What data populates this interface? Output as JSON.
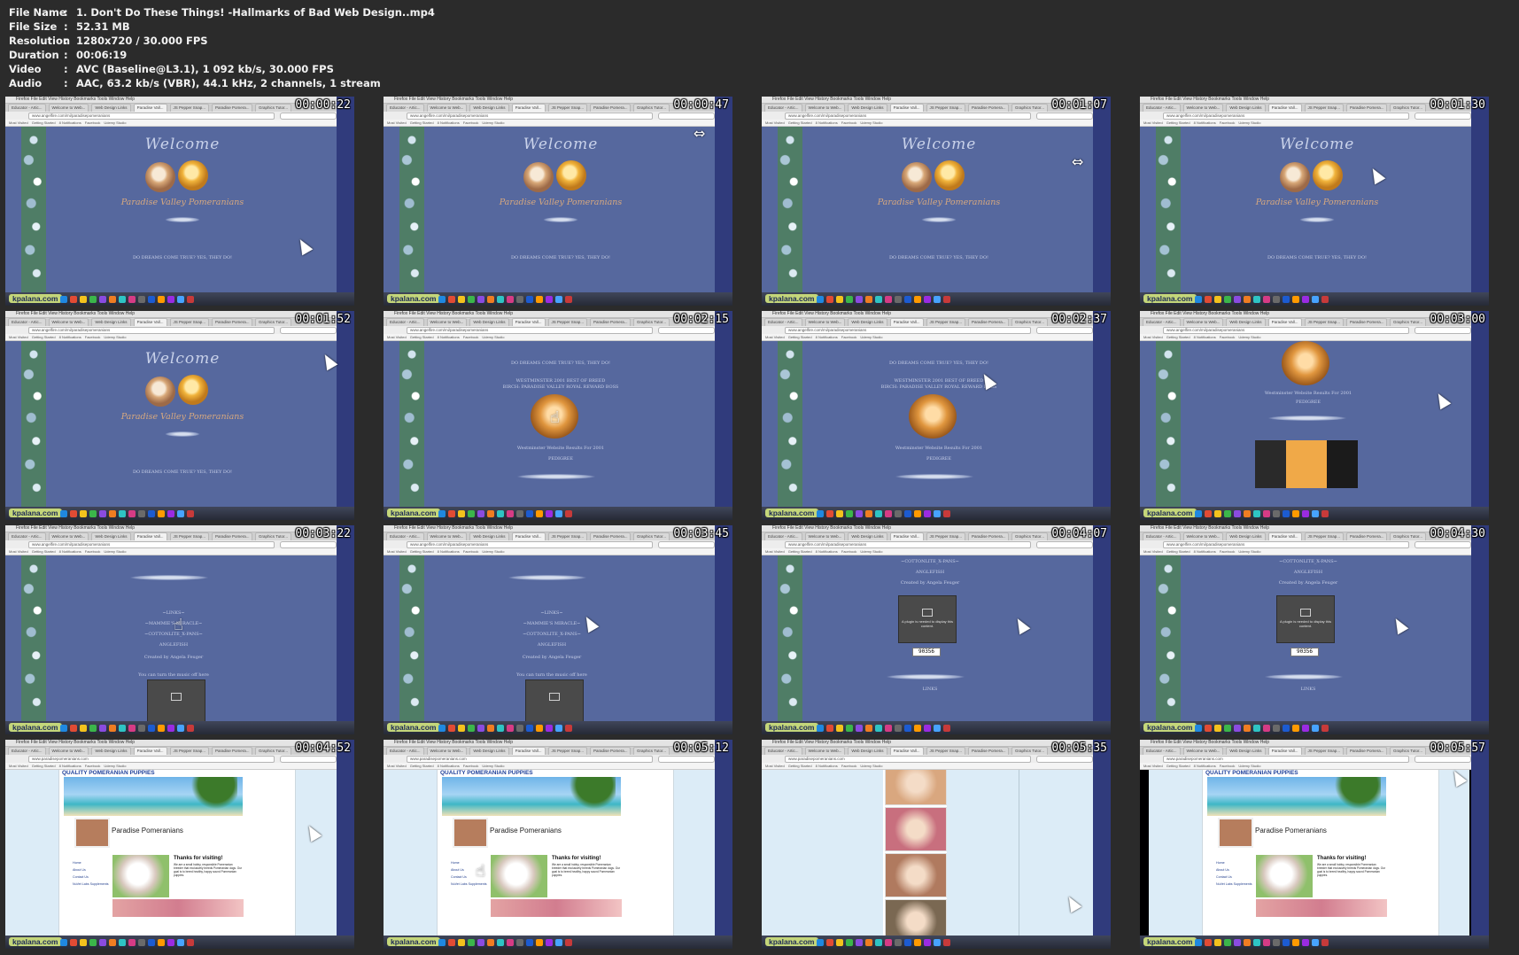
{
  "header": {
    "rows": [
      {
        "key": "File Name",
        "value": "1. Don't Do These Things! -Hallmarks of Bad Web Design..mp4"
      },
      {
        "key": "File Size",
        "value": "52.31 MB"
      },
      {
        "key": "Resolution",
        "value": "1280x720 / 30.000 FPS"
      },
      {
        "key": "Duration",
        "value": "00:06:19"
      },
      {
        "key": "Video",
        "value": "AVC (Baseline@L3.1), 1 092 kb/s, 30.000 FPS"
      },
      {
        "key": "Audio",
        "value": "AAC, 63.2 kb/s (VBR), 44.1 kHz, 2 channels, 1 stream"
      }
    ],
    "separator": ":"
  },
  "browser": {
    "app_menu": "Firefox  File  Edit  View  History  Bookmarks  Tools  Window  Help",
    "bookmarks": [
      "Most Visited",
      "Getting Started",
      "8 Notifications",
      "Facebook",
      "Udemy Studio"
    ],
    "tabs": [
      "Educator - Artic...",
      "Welcome to Web...",
      "Web Design Links",
      "Paradise Vall...",
      "JS Pepper Snap...",
      "Paradise Pomera...",
      "Graphics Tutor..."
    ],
    "url_angelfire": "www.angelfire.com/mi/paradisepomeranians",
    "url_paradise": "www.paradisepomeranians.com"
  },
  "brand": "kpalana.com",
  "site_text": {
    "welcome": "Welcome",
    "valley": "Paradise Valley Pomeranians",
    "dreams": "DO DREAMS COME TRUE?   YES, THEY DO!",
    "westminster": "WESTMINSTER 2001 BEST OF BREED",
    "birch": "BIRCH: PARADISE VALLEY ROYAL REWARD BOSS",
    "result": "Westminster Website Results For 2001",
    "pedigree": "PEDIGREE",
    "links": "~LINKS~",
    "miracle": "~MAMMIE'S MIRACLE~",
    "cottonlite": "~COTTONLITE_X-PANS~",
    "english": "ANGLEFISH",
    "created": "Created by Angela Feuger",
    "music": "You can turn the music off here",
    "plugin": "A plugin is needed to display this content.",
    "counter": "90356",
    "links_bottom": "LINKS",
    "quality": "QUALITY POMERANIAN PUPPIES",
    "pp_name": "Paradise Pomeranians",
    "thanks": "Thanks for visiting!",
    "pp_para": "We are a small hobby, responsible Pomeranian breeder that exclusively breeds Pomeranian dogs. Our goal is to breed healthy, happy sound Pomeranian puppies.",
    "nav": [
      "Home",
      "About Us",
      "Contact Us",
      "NuVet Labs Supplements"
    ]
  },
  "thumbnails": [
    {
      "timestamp": "00:00:22",
      "scene": "welcome"
    },
    {
      "timestamp": "00:00:47",
      "scene": "welcome"
    },
    {
      "timestamp": "00:01:07",
      "scene": "welcome"
    },
    {
      "timestamp": "00:01:30",
      "scene": "welcome"
    },
    {
      "timestamp": "00:01:52",
      "scene": "welcome"
    },
    {
      "timestamp": "00:02:15",
      "scene": "dog"
    },
    {
      "timestamp": "00:02:37",
      "scene": "dog"
    },
    {
      "timestamp": "00:03:00",
      "scene": "pedigree"
    },
    {
      "timestamp": "00:03:22",
      "scene": "links"
    },
    {
      "timestamp": "00:03:45",
      "scene": "links"
    },
    {
      "timestamp": "00:04:07",
      "scene": "plugin"
    },
    {
      "timestamp": "00:04:30",
      "scene": "plugin"
    },
    {
      "timestamp": "00:04:52",
      "scene": "pom"
    },
    {
      "timestamp": "00:05:12",
      "scene": "pom"
    },
    {
      "timestamp": "00:05:35",
      "scene": "photos"
    },
    {
      "timestamp": "00:05:57",
      "scene": "pom-black"
    }
  ],
  "colors": {
    "site_blue": "#56689e",
    "frame_blue": "#303b7c",
    "brand_green": "#c4d67a"
  }
}
